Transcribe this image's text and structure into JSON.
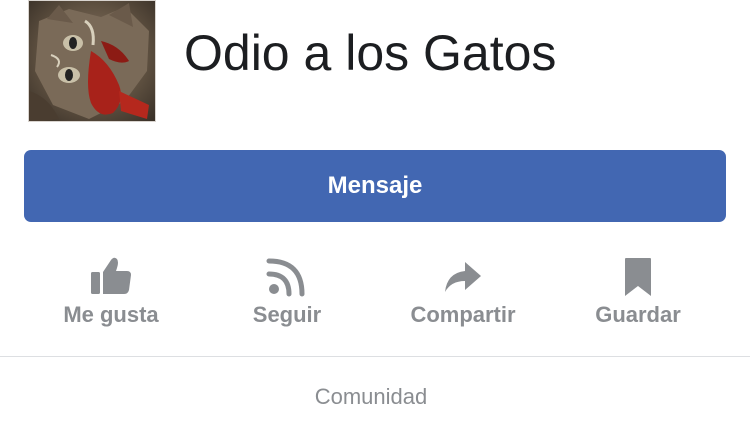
{
  "page": {
    "name": "Odio a los Gatos",
    "category": "Comunidad",
    "avatar_icon": "cat-photo"
  },
  "message_button": {
    "label": "Mensaje",
    "color": "#4267b2"
  },
  "actions": [
    {
      "label": "Me gusta",
      "icon": "thumbs-up-icon"
    },
    {
      "label": "Seguir",
      "icon": "rss-feed-icon"
    },
    {
      "label": "Compartir",
      "icon": "share-arrow-icon"
    },
    {
      "label": "Guardar",
      "icon": "bookmark-icon"
    }
  ],
  "colors": {
    "icon_gray": "#8a8d91",
    "text_dark": "#1c1e21"
  }
}
